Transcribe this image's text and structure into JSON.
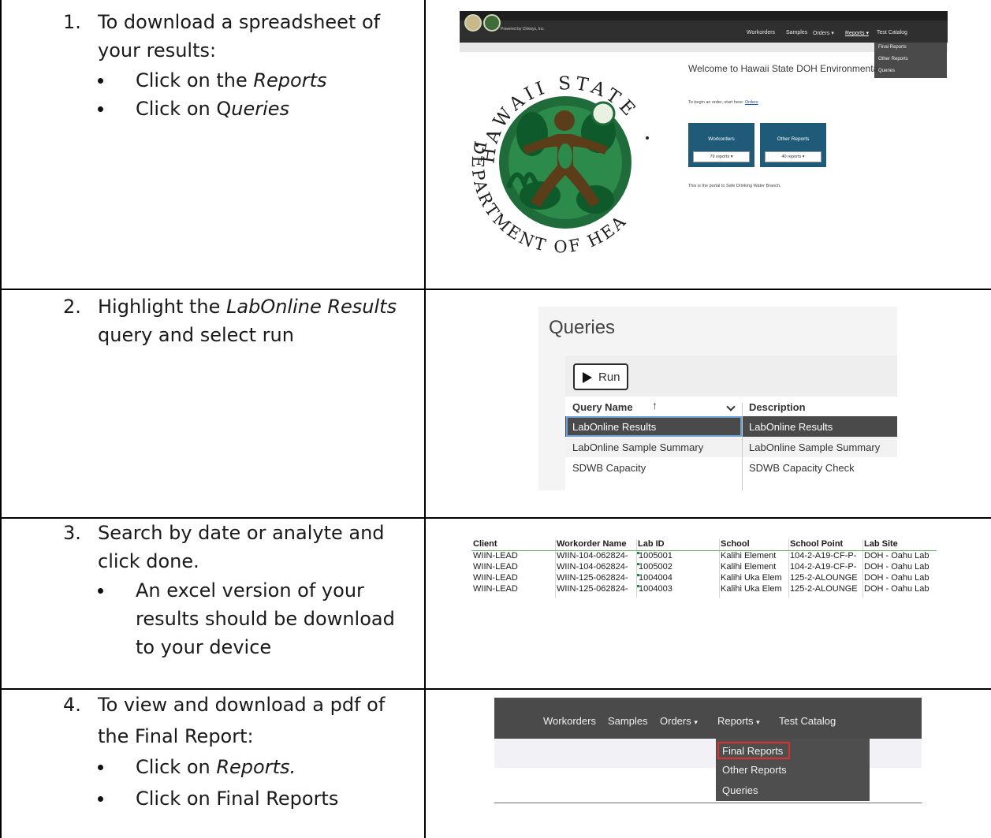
{
  "steps": [
    {
      "number": "1.",
      "lines": [
        "To download a spreadsheet of",
        "your results:"
      ],
      "bullets": [
        {
          "prefix": "Click on the ",
          "italic": "Reports",
          "suffix": ""
        },
        {
          "prefix": "Click on Q",
          "italic": "ueries",
          "suffix": ""
        }
      ]
    },
    {
      "number": "2.",
      "line1_prefix": "Highlight the ",
      "line1_italic": "LabOnline Results",
      "line2": "query and select run"
    },
    {
      "number": "3.",
      "lines": [
        "Search by date or analyte and",
        "click done."
      ],
      "bullets": [
        {
          "lines": [
            "An excel version of your",
            "results should be download",
            "to your device"
          ]
        }
      ]
    },
    {
      "number": "4.",
      "lines": [
        "To view and download a pdf of",
        "the Final Report:"
      ],
      "bullets": [
        {
          "prefix": "Click on ",
          "italic": "Reports.",
          "suffix": ""
        },
        {
          "prefix": "Click on Final Reports",
          "italic": "",
          "suffix": ""
        }
      ]
    }
  ],
  "shot1": {
    "powered_by": "Powered by Clinisys, Inc.",
    "nav": [
      "Workorders",
      "Samples",
      "Orders ▾",
      "Reports ▾",
      "Test Catalog"
    ],
    "dropdown": [
      "Final Reports",
      "Other Reports",
      "Queries"
    ],
    "welcome": "Welcome to Hawaii State DOH Environmenta",
    "begin_prefix": "To begin an order, start here: ",
    "begin_link": "Orders",
    "tiles": [
      {
        "title": "Workorders",
        "count": "79 reports ▾"
      },
      {
        "title": "Other Reports",
        "count": "40 reports ▾"
      }
    ],
    "portal_text": "This is the portal to Safe Drinking Water Branch.",
    "seal": {
      "top_text": "HAWAII STATE",
      "bottom_text": "DEPARTMENT OF HEALTH",
      "colors": {
        "ring": "#1f6b3a",
        "figure": "#5c3d1a",
        "leaf": "#1a7a3e"
      }
    }
  },
  "shot2": {
    "title": "Queries",
    "run_label": "Run",
    "col1_header": "Query Name",
    "sort_icon": "↑",
    "col2_header": "Description",
    "rows": [
      {
        "name": "LabOnline Results",
        "description": "LabOnline Results"
      },
      {
        "name": "LabOnline Sample Summary",
        "description": "LabOnline Sample Summary"
      },
      {
        "name": "SDWB Capacity",
        "description": "SDWB Capacity Check"
      }
    ]
  },
  "shot3": {
    "headers": [
      "Client",
      "Workorder Name",
      "Lab ID",
      "School",
      "School Point",
      "Lab Site"
    ],
    "rows": [
      [
        "WIIN-LEAD",
        "WIIN-104-062824-",
        "1005001",
        "Kalihi Element",
        "104-2-A19-CF-P-",
        "DOH - Oahu Lab"
      ],
      [
        "WIIN-LEAD",
        "WIIN-104-062824-",
        "1005002",
        "Kalihi Element",
        "104-2-A19-CF-P-",
        "DOH - Oahu Lab"
      ],
      [
        "WIIN-LEAD",
        "WIIN-125-062824-",
        "1004004",
        "Kalihi Uka Elem",
        "125-2-ALOUNGE",
        "DOH - Oahu Lab"
      ],
      [
        "WIIN-LEAD",
        "WIIN-125-062824-",
        "1004003",
        "Kalihi Uka Elem",
        "125-2-ALOUNGE",
        "DOH - Oahu Lab"
      ]
    ]
  },
  "shot4": {
    "nav": [
      "Workorders",
      "Samples",
      "Orders",
      "Reports",
      "Test Catalog"
    ],
    "caret": "▾",
    "dropdown": [
      "Final Reports",
      "Other Reports",
      "Queries"
    ],
    "highlight_color": "#e0302b"
  }
}
